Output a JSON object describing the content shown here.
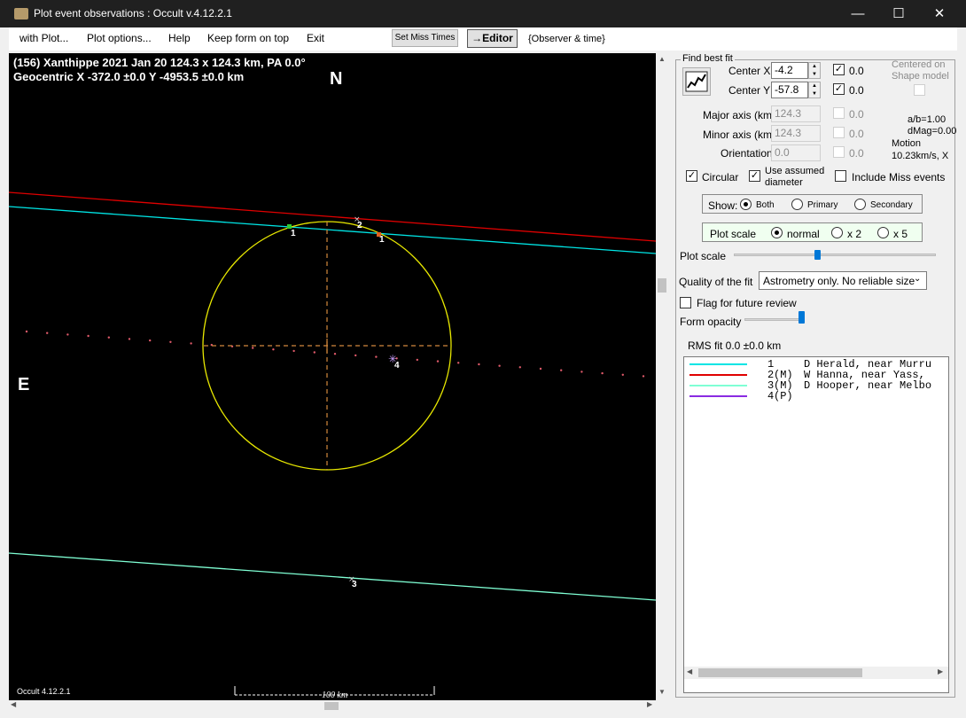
{
  "window": {
    "title": "Plot event observations : Occult v.4.12.2.1",
    "minimize_glyph": "—",
    "maximize_glyph": "☐",
    "close_glyph": "✕"
  },
  "menu": {
    "items": [
      "with Plot...",
      "Plot options...",
      "Help",
      "Keep form on top",
      "Exit"
    ],
    "set_miss_times": "Set Miss Times",
    "editor": "→Editor",
    "observer_time": "{Observer & time}"
  },
  "plot": {
    "header_line1": "(156) Xanthippe  2021 Jan 20   124.3 x 124.3 km, PA 0.0°",
    "header_line2": "Geocentric  X  -372.0 ±0.0  Y -4953.5 ±0.0 km",
    "north_label": "N",
    "east_label": "E",
    "footer_version": "Occult 4.12.2.1",
    "scale_label": "100 km",
    "chord_labels": [
      "1",
      "2",
      "1",
      "3",
      "4"
    ],
    "colors": {
      "chord1": "#00e5e5",
      "chord2": "#e00000",
      "chord3": "#7fffd4",
      "ellipse": "#e8e800",
      "axes": "#d2883c",
      "path_dots": "#e05a6a"
    }
  },
  "panel": {
    "find_best_fit": "Find best fit",
    "center_x_label": "Center X",
    "center_x_value": "-4.2",
    "center_x_check": "0.0",
    "center_y_label": "Center Y",
    "center_y_value": "-57.8",
    "center_y_check": "0.0",
    "centered_on_line1": "Centered on",
    "centered_on_line2": "Shape model",
    "major_label": "Major axis (km)",
    "major_value": "124.3",
    "major_check": "0.0",
    "minor_label": "Minor axis (km)",
    "minor_value": "124.3",
    "minor_check": "0.0",
    "orient_label": "Orientation",
    "orient_value": "0.0",
    "orient_check": "0.0",
    "ab_ratio": "a/b=1.00",
    "dmag": "dMag=0.00",
    "motion_label": "Motion",
    "motion_value": "10.23km/s, X",
    "circular": "Circular",
    "use_assumed_line1": "Use assumed",
    "use_assumed_line2": "diameter",
    "include_miss": "Include Miss events",
    "show_label": "Show:",
    "show_options": [
      "Both",
      "Primary",
      "Secondary"
    ],
    "plot_scale_label": "Plot scale",
    "plot_scale_options": [
      "normal",
      "x 2",
      "x 5"
    ],
    "plot_scale_slider_label": "Plot scale",
    "quality_label": "Quality of the fit",
    "quality_value": "Astrometry only. No reliable size",
    "flag_review": "Flag for future review",
    "form_opacity": "Form opacity",
    "rms_fit": "RMS fit 0.0 ±0.0 km",
    "observers": [
      {
        "num": "1",
        "tag": "",
        "text": "D Herald, near Murru",
        "color": "#00e5e5"
      },
      {
        "num": "2",
        "tag": "(M)",
        "text": "W Hanna, near Yass,",
        "color": "#e00000"
      },
      {
        "num": "3",
        "tag": "(M)",
        "text": "D Hooper, near Melbo",
        "color": "#7fffd4"
      },
      {
        "num": "4",
        "tag": "(P)",
        "text": "",
        "color": "#8a2be2"
      }
    ]
  }
}
